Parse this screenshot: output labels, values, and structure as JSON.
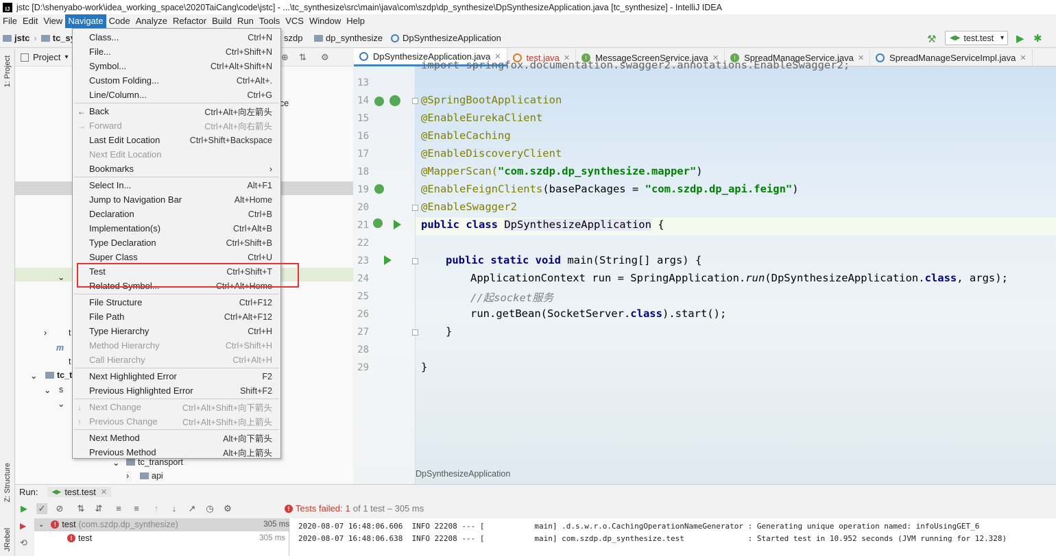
{
  "window": {
    "title": "jstc [D:\\shenyabo-work\\idea_working_space\\2020TaiCang\\code\\jstc] - ...\\tc_synthesize\\src\\main\\java\\com\\szdp\\dp_synthesize\\DpSynthesizeApplication.java [tc_synthesize] - IntelliJ IDEA",
    "app_icon": "IJ"
  },
  "menubar": [
    "File",
    "Edit",
    "View",
    "Navigate",
    "Code",
    "Analyze",
    "Refactor",
    "Build",
    "Run",
    "Tools",
    "VCS",
    "Window",
    "Help"
  ],
  "navbar": {
    "crumbs": [
      "jstc",
      "tc_sy",
      "szdp",
      "dp_synthesize",
      "DpSynthesizeApplication"
    ],
    "run_config": "test.test"
  },
  "left_strip": {
    "project_label": "1: Project",
    "structure_label": "Z: Structure",
    "jrebel_label": "JRebel"
  },
  "project_panel": {
    "title": "Project",
    "tree": [
      "ce",
      "t",
      "m",
      "t",
      "tc_tr",
      "s",
      "tc_transport",
      "api"
    ]
  },
  "tabs": [
    {
      "label": "DpSynthesizeApplication.java",
      "type": "class",
      "active": true
    },
    {
      "label": "test.java",
      "type": "class",
      "active": false
    },
    {
      "label": "MessageScreenService.java",
      "type": "interface",
      "active": false
    },
    {
      "label": "SpreadManageService.java",
      "type": "interface",
      "active": false
    },
    {
      "label": "SpreadManageServiceImpl.java",
      "type": "class",
      "active": false
    }
  ],
  "editor": {
    "line_numbers": [
      "13",
      "14",
      "15",
      "16",
      "17",
      "18",
      "19",
      "20",
      "21",
      "22",
      "23",
      "24",
      "25",
      "26",
      "27",
      "28",
      "29"
    ],
    "partial_top_line": "import springfox.documentation.swagger2.annotations.EnableSwagger2;",
    "lines": {
      "l14": "@SpringBootApplication",
      "l15": "@EnableEurekaClient",
      "l16": "@EnableCaching",
      "l17": "@EnableDiscoveryClient",
      "l18_ann": "@MapperScan(",
      "l18_str": "\"com.szdp.dp_synthesize.mapper\"",
      "l18_end": ")",
      "l19_ann": "@EnableFeignClients",
      "l19_mid": "(basePackages = ",
      "l19_str": "\"com.szdp.dp_api.feign\"",
      "l19_end": ")",
      "l20": "@EnableSwagger2",
      "l21_kw": "public class ",
      "l21_name": "DpSynthesizeApplication",
      "l21_end": " {",
      "l23_kw": "public static void ",
      "l23_rest": "main(String[] args) {",
      "l24_a": "ApplicationContext run = SpringApplication.",
      "l24_run": "run",
      "l24_b": "(DpSynthesizeApplication.",
      "l24_kw": "class",
      "l24_c": ", args);",
      "l25": "//起socket服务",
      "l26_a": "run.getBean(SocketServer.",
      "l26_kw": "class",
      "l26_b": ").start();",
      "l27": "}",
      "l29": "}"
    },
    "footer": "DpSynthesizeApplication"
  },
  "navigate_menu": {
    "items": [
      {
        "label": "Class...",
        "shortcut": "Ctrl+N",
        "disabled": false
      },
      {
        "label": "File...",
        "shortcut": "Ctrl+Shift+N",
        "disabled": false
      },
      {
        "label": "Symbol...",
        "shortcut": "Ctrl+Alt+Shift+N",
        "disabled": false
      },
      {
        "label": "Custom Folding...",
        "shortcut": "Ctrl+Alt+.",
        "disabled": false
      },
      {
        "label": "Line/Column...",
        "shortcut": "Ctrl+G",
        "disabled": false
      },
      {
        "label": "Back",
        "shortcut": "Ctrl+Alt+向左箭头",
        "disabled": false
      },
      {
        "label": "Forward",
        "shortcut": "Ctrl+Alt+向右箭头",
        "disabled": true
      },
      {
        "label": "Last Edit Location",
        "shortcut": "Ctrl+Shift+Backspace",
        "disabled": false
      },
      {
        "label": "Next Edit Location",
        "shortcut": "",
        "disabled": true
      },
      {
        "label": "Bookmarks",
        "shortcut": "›",
        "disabled": false
      },
      {
        "label": "Select In...",
        "shortcut": "Alt+F1",
        "disabled": false
      },
      {
        "label": "Jump to Navigation Bar",
        "shortcut": "Alt+Home",
        "disabled": false
      },
      {
        "label": "Declaration",
        "shortcut": "Ctrl+B",
        "disabled": false
      },
      {
        "label": "Implementation(s)",
        "shortcut": "Ctrl+Alt+B",
        "disabled": false
      },
      {
        "label": "Type Declaration",
        "shortcut": "Ctrl+Shift+B",
        "disabled": false
      },
      {
        "label": "Super Class",
        "shortcut": "Ctrl+U",
        "disabled": false
      },
      {
        "label": "Test",
        "shortcut": "Ctrl+Shift+T",
        "disabled": false
      },
      {
        "label": "Related Symbol...",
        "shortcut": "Ctrl+Alt+Home",
        "disabled": false
      },
      {
        "label": "File Structure",
        "shortcut": "Ctrl+F12",
        "disabled": false
      },
      {
        "label": "File Path",
        "shortcut": "Ctrl+Alt+F12",
        "disabled": false
      },
      {
        "label": "Type Hierarchy",
        "shortcut": "Ctrl+H",
        "disabled": false
      },
      {
        "label": "Method Hierarchy",
        "shortcut": "Ctrl+Shift+H",
        "disabled": true
      },
      {
        "label": "Call Hierarchy",
        "shortcut": "Ctrl+Alt+H",
        "disabled": true
      },
      {
        "label": "Next Highlighted Error",
        "shortcut": "F2",
        "disabled": false
      },
      {
        "label": "Previous Highlighted Error",
        "shortcut": "Shift+F2",
        "disabled": false
      },
      {
        "label": "Next Change",
        "shortcut": "Ctrl+Alt+Shift+向下箭头",
        "disabled": true
      },
      {
        "label": "Previous Change",
        "shortcut": "Ctrl+Alt+Shift+向上箭头",
        "disabled": true
      },
      {
        "label": "Next Method",
        "shortcut": "Alt+向下箭头",
        "disabled": false
      },
      {
        "label": "Previous Method",
        "shortcut": "Alt+向上箭头",
        "disabled": false
      }
    ]
  },
  "run_panel": {
    "label": "Run:",
    "tab": "test.test",
    "status_prefix": "Tests failed:",
    "status_count": "1",
    "status_rest": "of 1 test – 305 ms",
    "tree": [
      {
        "name": "test",
        "detail": "(com.szdp.dp_synthesize)",
        "time": "305 ms"
      },
      {
        "name": "test",
        "detail": "",
        "time": "305 ms"
      }
    ],
    "console": [
      "2020-08-07 16:48:06.606  INFO 22208 --- [           main] .d.s.w.r.o.CachingOperationNameGenerator : Generating unique operation named: infoUsingGET_6",
      "2020-08-07 16:48:06.638  INFO 22208 --- [           main] com.szdp.dp_synthesize.test              : Started test in 10.952 seconds (JVM running for 12.328)"
    ]
  },
  "colors": {
    "menu_highlight": "#2675bf",
    "annotation_box": "#e53333",
    "annotation": "#808000",
    "keyword": "#000080",
    "string": "#008000"
  }
}
